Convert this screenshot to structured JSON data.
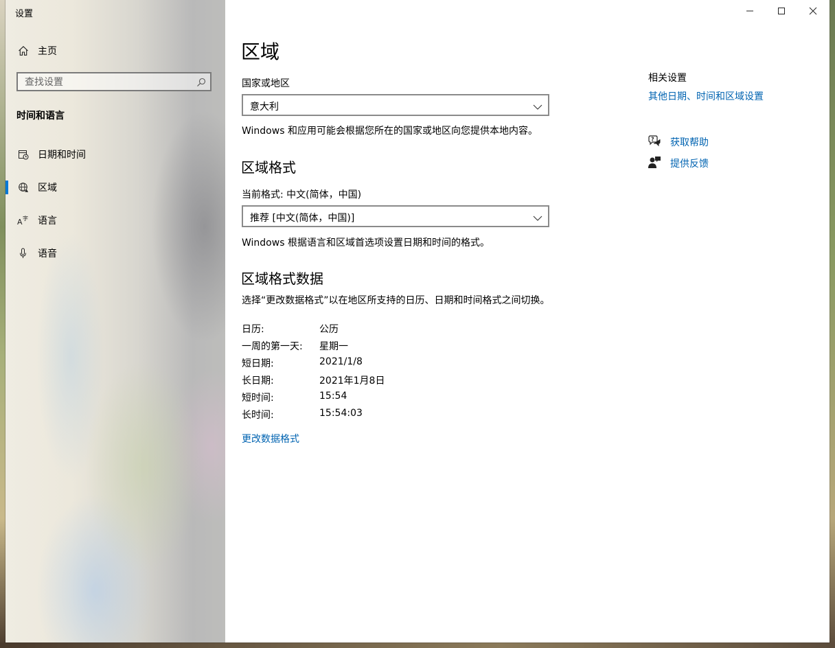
{
  "window": {
    "title": "设置"
  },
  "sidebar": {
    "home_label": "主页",
    "search_placeholder": "查找设置",
    "section_title": "时间和语言",
    "items": [
      {
        "label": "日期和时间",
        "icon": "calendar-clock-icon",
        "selected": false
      },
      {
        "label": "区域",
        "icon": "globe-icon",
        "selected": true
      },
      {
        "label": "语言",
        "icon": "language-icon",
        "selected": false
      },
      {
        "label": "语音",
        "icon": "microphone-icon",
        "selected": false
      }
    ]
  },
  "main": {
    "title": "区域",
    "country": {
      "label": "国家或地区",
      "value": "意大利",
      "description": "Windows 和应用可能会根据您所在的国家或地区向您提供本地内容。"
    },
    "format": {
      "heading": "区域格式",
      "current": "当前格式: 中文(简体，中国)",
      "value": "推荐 [中文(简体，中国)]",
      "description": "Windows 根据语言和区域首选项设置日期和时间的格式。"
    },
    "format_data": {
      "heading": "区域格式数据",
      "description": "选择“更改数据格式”以在地区所支持的日历、日期和时间格式之间切换。",
      "rows": [
        {
          "key": "日历:",
          "value": "公历"
        },
        {
          "key": "一周的第一天:",
          "value": "星期一"
        },
        {
          "key": "短日期:",
          "value": "2021/1/8"
        },
        {
          "key": "长日期:",
          "value": "2021年1月8日"
        },
        {
          "key": "短时间:",
          "value": "15:54"
        },
        {
          "key": "长时间:",
          "value": "15:54:03"
        }
      ],
      "change_link": "更改数据格式"
    }
  },
  "related": {
    "title": "相关设置",
    "link": "其他日期、时间和区域设置",
    "help_label": "获取帮助",
    "feedback_label": "提供反馈"
  },
  "colors": {
    "accent": "#0078d7",
    "link": "#0063b1"
  }
}
